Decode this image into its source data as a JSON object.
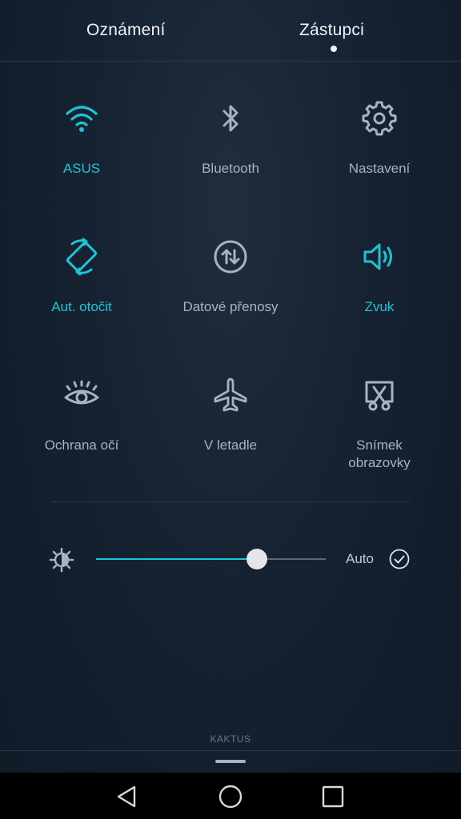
{
  "tabs": [
    {
      "label": "Oznámení"
    },
    {
      "label": "Zástupci"
    }
  ],
  "tiles": [
    {
      "label": "ASUS",
      "icon": "wifi-icon",
      "active": true
    },
    {
      "label": "Bluetooth",
      "icon": "bluetooth-icon",
      "active": false
    },
    {
      "label": "Nastavení",
      "icon": "gear-icon",
      "active": false
    },
    {
      "label": "Aut. otočit",
      "icon": "auto-rotate-icon",
      "active": true
    },
    {
      "label": "Datové přenosy",
      "icon": "mobile-data-icon",
      "active": false
    },
    {
      "label": "Zvuk",
      "icon": "speaker-icon",
      "active": true
    },
    {
      "label": "Ochrana očí",
      "icon": "eye-icon",
      "active": false
    },
    {
      "label": "V letadle",
      "icon": "airplane-icon",
      "active": false
    },
    {
      "label": "Snímek obrazovky",
      "icon": "screenshot-icon",
      "active": false
    }
  ],
  "brightness": {
    "level": 0.7,
    "auto_label": "Auto",
    "auto_checked": true
  },
  "carrier": "KAKTUS",
  "colors": {
    "accent": "#19c5d8",
    "inactive": "#a9b3bd"
  }
}
